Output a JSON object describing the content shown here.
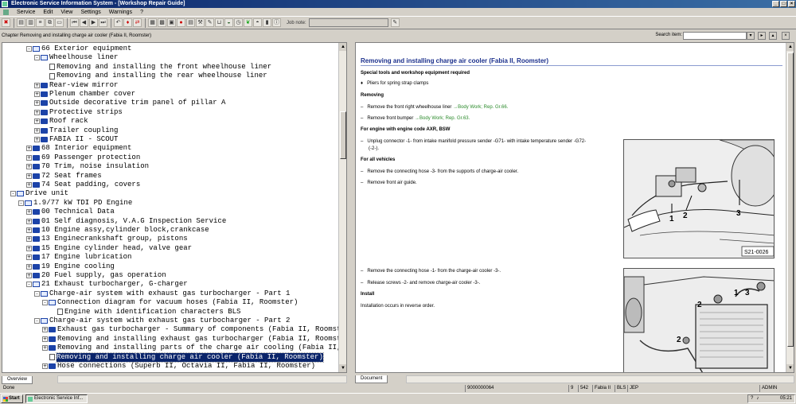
{
  "window": {
    "title": "Electronic Service Information System - [Workshop Repair Guide]"
  },
  "menu": [
    "Service",
    "Edit",
    "View",
    "Settings",
    "Warnings",
    "?"
  ],
  "toolbar": {
    "job_note_label": "Job note:"
  },
  "chapter": {
    "text": "Chapter Removing and installing charge air cooler (Fabia II, Roomster)",
    "search_label": "Search item:",
    "search_value": ""
  },
  "tree": [
    {
      "text": "66 Exterior equipment",
      "indent": 2,
      "toggle": "-",
      "icon": "open"
    },
    {
      "text": "Wheelhouse liner",
      "indent": 3,
      "toggle": "-",
      "icon": "open"
    },
    {
      "text": "Removing and installing the front wheelhouse liner",
      "indent": 4,
      "toggle": "",
      "icon": "doc"
    },
    {
      "text": "Removing and installing the rear wheelhouse liner",
      "indent": 4,
      "toggle": "",
      "icon": "doc"
    },
    {
      "text": "Rear-view mirror",
      "indent": 3,
      "toggle": "+",
      "icon": "closed"
    },
    {
      "text": "Plenum chamber cover",
      "indent": 3,
      "toggle": "+",
      "icon": "closed"
    },
    {
      "text": "Outside decorative trim panel of pillar A",
      "indent": 3,
      "toggle": "+",
      "icon": "closed"
    },
    {
      "text": "Protective strips",
      "indent": 3,
      "toggle": "+",
      "icon": "closed"
    },
    {
      "text": "Roof rack",
      "indent": 3,
      "toggle": "+",
      "icon": "closed"
    },
    {
      "text": "Trailer coupling",
      "indent": 3,
      "toggle": "+",
      "icon": "closed"
    },
    {
      "text": "FABIA II - SCOUT",
      "indent": 3,
      "toggle": "+",
      "icon": "closed"
    },
    {
      "text": "68 Interior equipment",
      "indent": 2,
      "toggle": "+",
      "icon": "closed"
    },
    {
      "text": "69 Passenger protection",
      "indent": 2,
      "toggle": "+",
      "icon": "closed"
    },
    {
      "text": "70 Trim, noise insulation",
      "indent": 2,
      "toggle": "+",
      "icon": "closed"
    },
    {
      "text": "72 Seat frames",
      "indent": 2,
      "toggle": "+",
      "icon": "closed"
    },
    {
      "text": "74 Seat padding, covers",
      "indent": 2,
      "toggle": "+",
      "icon": "closed"
    },
    {
      "text": "Drive unit",
      "indent": 0,
      "toggle": "-",
      "icon": "open"
    },
    {
      "text": "1.9/77 kW TDI PD Engine",
      "indent": 1,
      "toggle": "-",
      "icon": "open"
    },
    {
      "text": "00 Technical Data",
      "indent": 2,
      "toggle": "+",
      "icon": "closed"
    },
    {
      "text": "01 Self diagnosis, V.A.G Inspection Service",
      "indent": 2,
      "toggle": "+",
      "icon": "closed"
    },
    {
      "text": "10 Engine assy,cylinder block,crankcase",
      "indent": 2,
      "toggle": "+",
      "icon": "closed"
    },
    {
      "text": "13 Enginecrankshaft group, pistons",
      "indent": 2,
      "toggle": "+",
      "icon": "closed"
    },
    {
      "text": "15 Engine cylinder head, valve gear",
      "indent": 2,
      "toggle": "+",
      "icon": "closed"
    },
    {
      "text": "17 Engine lubrication",
      "indent": 2,
      "toggle": "+",
      "icon": "closed"
    },
    {
      "text": "19 Engine cooling",
      "indent": 2,
      "toggle": "+",
      "icon": "closed"
    },
    {
      "text": "20 Fuel supply, gas operation",
      "indent": 2,
      "toggle": "+",
      "icon": "closed"
    },
    {
      "text": "21 Exhaust turbocharger, G-charger",
      "indent": 2,
      "toggle": "-",
      "icon": "open"
    },
    {
      "text": "Charge-air system with exhaust gas turbocharger - Part 1",
      "indent": 3,
      "toggle": "-",
      "icon": "open"
    },
    {
      "text": "Connection diagram for vacuum hoses (Fabia II, Roomster)",
      "indent": 4,
      "toggle": "-",
      "icon": "open"
    },
    {
      "text": "Engine with identification characters BLS",
      "indent": 5,
      "toggle": "",
      "icon": "doc"
    },
    {
      "text": "Charge-air system with exhaust gas turbocharger - Part 2",
      "indent": 3,
      "toggle": "-",
      "icon": "open"
    },
    {
      "text": "Exhaust gas turbocharger - Summary of components (Fabia II, Roomster)",
      "indent": 4,
      "toggle": "+",
      "icon": "closed"
    },
    {
      "text": "Removing and installing exhaust gas turbocharger (Fabia II, Roomster)",
      "indent": 4,
      "toggle": "+",
      "icon": "closed"
    },
    {
      "text": "Removing and installing parts of the charge air cooling (Fabia II, Roo",
      "indent": 4,
      "toggle": "+",
      "icon": "closed"
    },
    {
      "text": "Removing and installing charge air cooler (Fabia II, Roomster)",
      "indent": 4,
      "toggle": "",
      "icon": "doc",
      "selected": true
    },
    {
      "text": "Hose connections (Superb II, Octavia II, Fabia II, Roomster)",
      "indent": 4,
      "toggle": "+",
      "icon": "closed"
    }
  ],
  "left_tab": "Overview",
  "right_tab": "Document",
  "document": {
    "title": "Removing and installing charge air cooler (Fabia II, Roomster)",
    "special_tools_heading": "Special tools and workshop equipment required",
    "tool_item": "Pliers for spring strap clamps",
    "removing_heading": "Removing",
    "step1_text": "Remove the front right wheelhouse liner ",
    "step1_link": "→Body Work; Rep. Gr.66.",
    "step2_text": "Remove front bumper ",
    "step2_link": "→Body Work; Rep. Gr.63.",
    "engine_heading": "For engine with engine code AXR, BSW",
    "step3_line1": "Unplug connector -1- from intake manifold pressure sender -G71- with intake temperature sender -G72-",
    "step3_line2": "(-2-).",
    "all_vehicles_heading": "For all vehicles",
    "step4": "Remove the connecting hose -3- from the supports of charge-air cooler.",
    "step5": "Remove front air guide.",
    "step6": "Remove the connecting hose -1- from the charge-air cooler -3-.",
    "step7": "Release screws -2- and remove charge-air cooler -3-.",
    "install_heading": "Install",
    "install_text": "Installation occurs in reverse order.",
    "figure1_code": "S21-0026",
    "figure1_labels": [
      "1",
      "2",
      "3"
    ],
    "figure2_labels": [
      "1",
      "2",
      "3",
      "2"
    ]
  },
  "status": {
    "left": "Done",
    "doc_id": "9000000064",
    "page": "9",
    "num": "542",
    "model": "Fabia II",
    "code": "BLS",
    "extra": "JEP",
    "user": "ADMIN"
  },
  "taskbar": {
    "start": "Start",
    "app_item": "Electronic Service Inf...",
    "clock": "05:21"
  }
}
